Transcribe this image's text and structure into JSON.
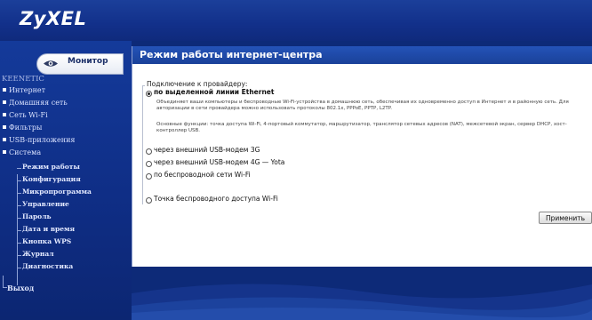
{
  "header": {
    "logo": "ZyXEL"
  },
  "sidebar": {
    "monitor_tab": "Монитор",
    "section_title": "KEENETIC",
    "items": [
      {
        "label": "Интернет"
      },
      {
        "label": "Домашняя сеть"
      },
      {
        "label": "Сеть Wi-Fi"
      },
      {
        "label": "Фильтры"
      },
      {
        "label": "USB-приложения"
      },
      {
        "label": "Система"
      }
    ],
    "system_subitems": [
      {
        "label": "Режим работы"
      },
      {
        "label": "Конфигурация"
      },
      {
        "label": "Микропрограмма"
      },
      {
        "label": "Управление"
      },
      {
        "label": "Пароль"
      },
      {
        "label": "Дата и время"
      },
      {
        "label": "Кнопка WPS"
      },
      {
        "label": "Журнал"
      },
      {
        "label": "Диагностика"
      }
    ],
    "exit": "Выход"
  },
  "main": {
    "title": "Режим работы интернет-центра",
    "legend": "Подключение к провайдеру:",
    "options": [
      {
        "label": "по выделенной линии Ethernet",
        "selected": true
      },
      {
        "label": "через внешний USB-модем 3G",
        "selected": false
      },
      {
        "label": "через внешний USB-модем 4G — Yota",
        "selected": false
      },
      {
        "label": "по беспроводной сети Wi-Fi",
        "selected": false
      },
      {
        "label": "Точка беспроводного доступа Wi-Fi",
        "selected": false
      }
    ],
    "desc1": "Объединяет ваши компьютеры и беспроводные Wi-Fi-устройства в домашнюю сеть, обеспечивая их одновременно доступ в Интернет и в районную сеть. Для авторизации в сети провайдера можно использовать протоколы 802.1x, PPPoE, PPTP, L2TP.",
    "desc2": "Основные функции: точка доступа Wi-Fi, 4-портовый коммутатор, маршрутизатор, транслятор сетевых адресов (NAT), межсетевой экран, сервер DHCP, хост-контроллер USB.",
    "apply_label": "Применить"
  }
}
